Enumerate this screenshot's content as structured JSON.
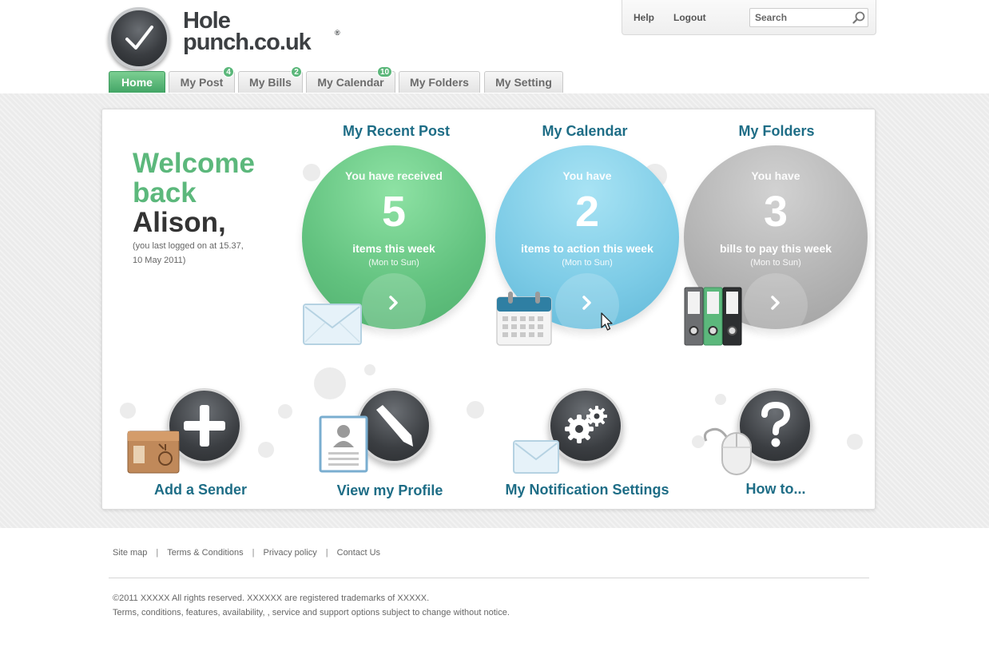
{
  "brand": {
    "line1": "Hole",
    "line2": "punch.co.uk",
    "reg": "®"
  },
  "utility": {
    "help": "Help",
    "logout": "Logout",
    "search_placeholder": "Search"
  },
  "tabs": [
    {
      "label": "Home",
      "badge": ""
    },
    {
      "label": "My Post",
      "badge": "4"
    },
    {
      "label": "My Bills",
      "badge": "2"
    },
    {
      "label": "My Calendar",
      "badge": "10"
    },
    {
      "label": "My Folders",
      "badge": ""
    },
    {
      "label": "My Setting",
      "badge": ""
    }
  ],
  "welcome": {
    "line1": "Welcome",
    "line2": "back",
    "name": "Alison,",
    "last_login": "(you last logged on at 15.37, 10 May 2011)"
  },
  "summaries": [
    {
      "title": "My Recent Post",
      "lead": "You have received",
      "count": "5",
      "sub": "items this week",
      "range": "(Mon to Sun)"
    },
    {
      "title": "My Calendar",
      "lead": "You have",
      "count": "2",
      "sub": "items to action this week",
      "range": "(Mon to Sun)"
    },
    {
      "title": "My Folders",
      "lead": "You have",
      "count": "3",
      "sub": "bills to pay this week",
      "range": "(Mon to Sun)"
    }
  ],
  "actions": [
    {
      "label": "Add a Sender"
    },
    {
      "label": "View my Profile"
    },
    {
      "label": "My Notification Settings"
    },
    {
      "label": "How to..."
    }
  ],
  "footer": {
    "links": [
      "Site map",
      "Terms & Conditions",
      "Privacy policy",
      "Contact Us"
    ],
    "legal1": "©2011 XXXXX All rights reserved. XXXXXX  are registered trademarks of XXXXX.",
    "legal2": "Terms, conditions, features, availability, , service and support options subject to change without notice."
  },
  "colors": {
    "brand_green": "#5cb87c",
    "title_teal": "#1e6d86",
    "post_green": "#62c27f",
    "calendar_blue": "#7ccbe6",
    "folders_grey": "#b3b3b3"
  }
}
